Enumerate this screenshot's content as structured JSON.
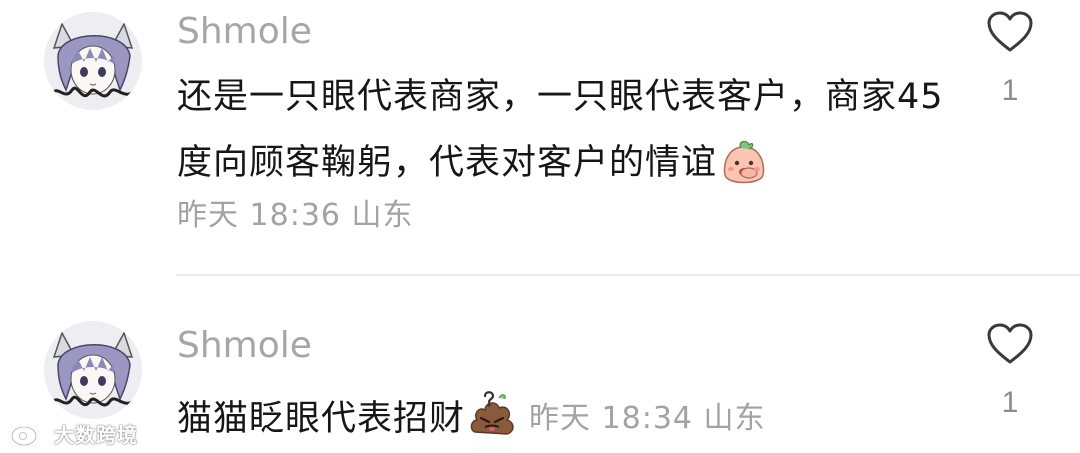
{
  "comments": [
    {
      "username": "Shmole",
      "text": "还是一只眼代表商家，一只眼代表客户，商家45度向顾客鞠躬，代表对客户的情谊",
      "emoji": "peach-cover-mouth-emoji",
      "time": "昨天 18:36",
      "location": "山东",
      "meta": "昨天 18:36 山东",
      "likes": "1"
    },
    {
      "username": "Shmole",
      "text": "猫猫眨眼代表招财",
      "emoji": "confused-poop-emoji",
      "time": "昨天 18:34",
      "location": "山东",
      "meta": "昨天 18:34 山东",
      "likes": "1"
    }
  ],
  "watermark": {
    "text": "大数跨境",
    "icon": "weibo-logo-icon"
  },
  "colors": {
    "username": "#a6a6a6",
    "text": "#161616",
    "meta": "#a3a3a3",
    "divider": "#ececec"
  }
}
